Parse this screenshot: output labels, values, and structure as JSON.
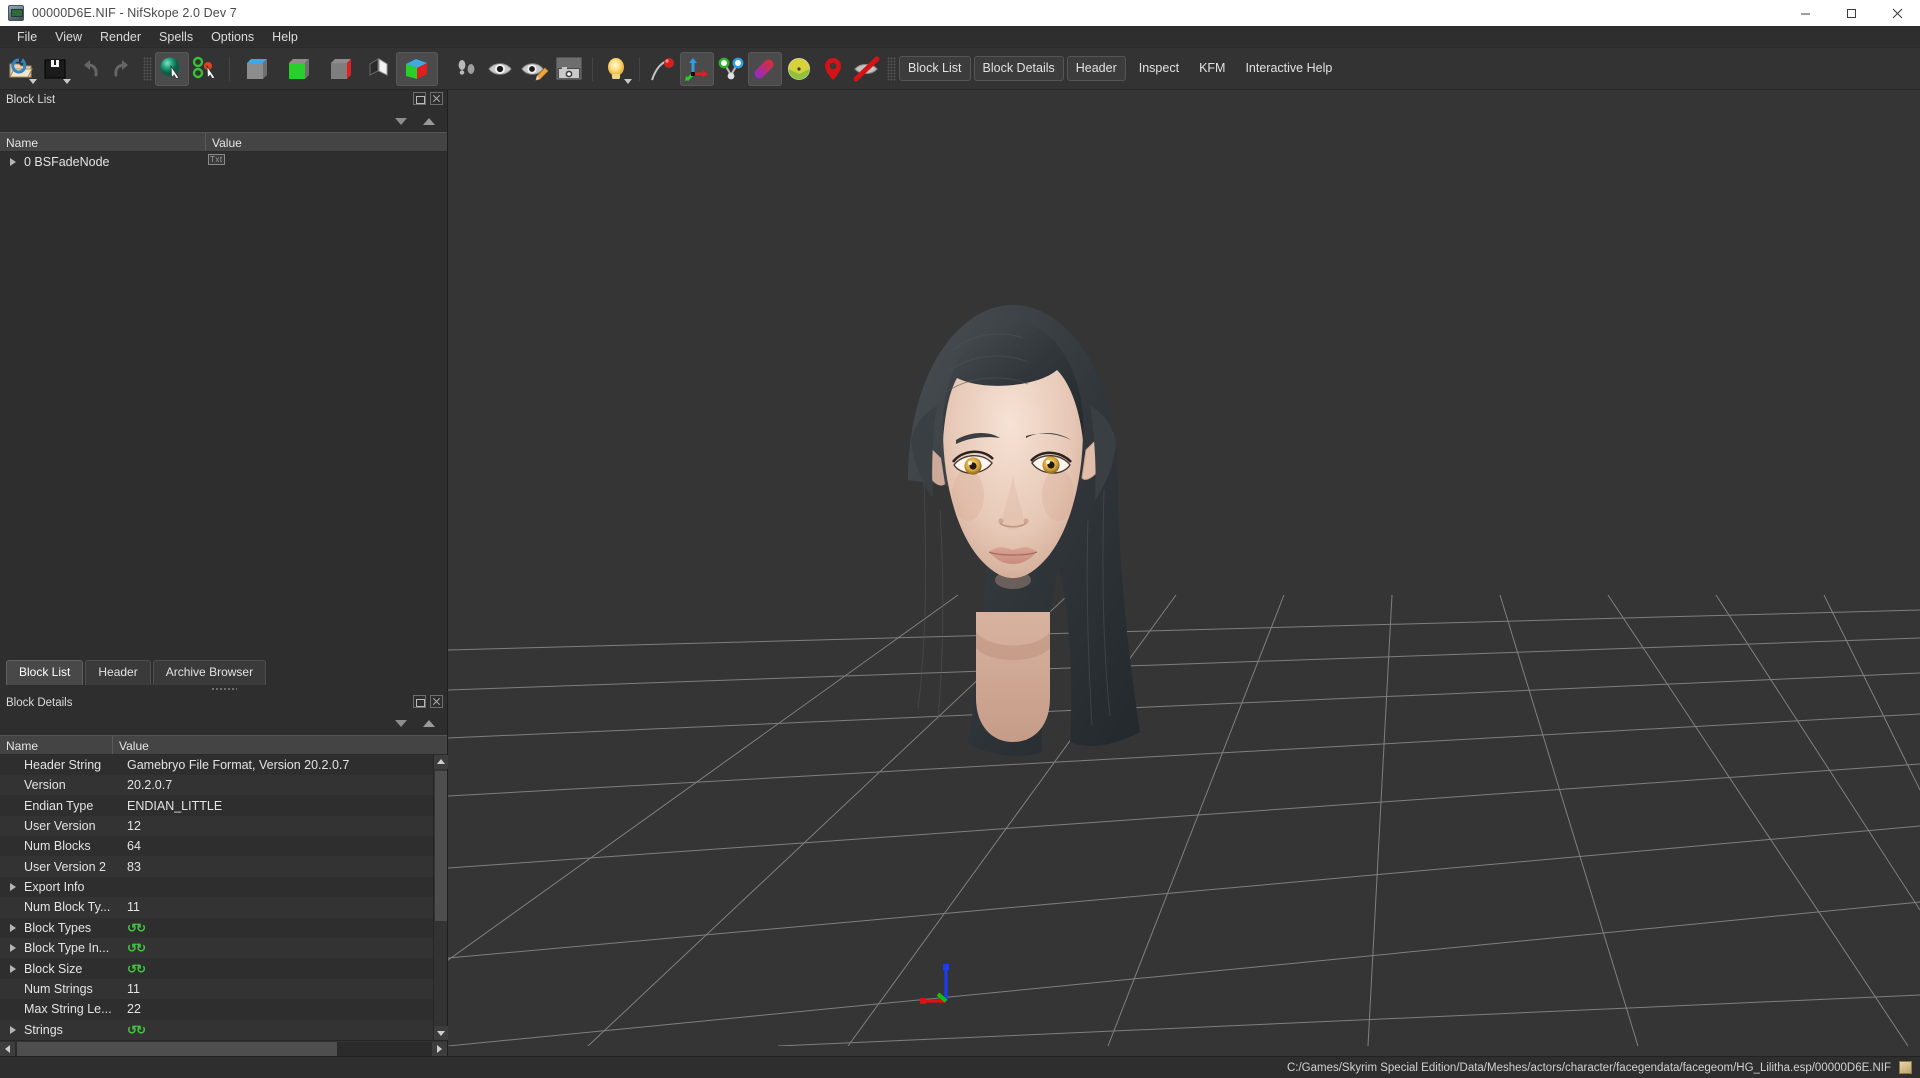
{
  "window": {
    "title": "00000D6E.NIF - NifSkope 2.0 Dev 7",
    "app_icon": "nifskope-app-icon",
    "buttons": {
      "minimize": "minimize-button",
      "maximize": "maximize-button",
      "close": "close-button"
    }
  },
  "menubar": {
    "items": [
      {
        "label": "File"
      },
      {
        "label": "View"
      },
      {
        "label": "Render"
      },
      {
        "label": "Spells"
      },
      {
        "label": "Options"
      },
      {
        "label": "Help"
      }
    ]
  },
  "toolbar": {
    "file_tools": [
      {
        "name": "open-file-button",
        "icon": "open-folder-icon",
        "has_dropdown": true
      },
      {
        "name": "save-file-button",
        "icon": "floppy-disk-icon",
        "has_dropdown": true
      },
      {
        "name": "undo-button",
        "icon": "undo-arrow-icon",
        "disabled": true
      },
      {
        "name": "redo-button",
        "icon": "redo-arrow-icon",
        "disabled": true
      }
    ],
    "view_tools": [
      {
        "name": "select-object-button",
        "icon": "green-sphere-cursor-icon",
        "active": true
      },
      {
        "name": "select-vertex-button",
        "icon": "nodes-cursor-icon",
        "active": false
      },
      {
        "name": "view-top-button",
        "icon": "top-view-cube-icon"
      },
      {
        "name": "view-front-button",
        "icon": "front-view-cube-icon"
      },
      {
        "name": "view-side-button",
        "icon": "side-view-cube-icon"
      },
      {
        "name": "view-flip-button",
        "icon": "flip-view-icon"
      },
      {
        "name": "view-perspective-button",
        "icon": "perspective-cube-icon",
        "active": true
      }
    ],
    "render_tools": [
      {
        "name": "walk-mode-button",
        "icon": "footprints-icon"
      },
      {
        "name": "show-hidden-button",
        "icon": "eye-icon"
      },
      {
        "name": "draw-nodes-button",
        "icon": "eye-pencil-icon"
      },
      {
        "name": "screenshot-button",
        "icon": "camera-icon"
      },
      {
        "name": "lighting-button",
        "icon": "light-bulb-icon",
        "has_dropdown": true
      },
      {
        "name": "draw-havok-button",
        "icon": "havok-curve-icon"
      },
      {
        "name": "draw-axes-button",
        "icon": "axes-arrows-icon",
        "active": true
      },
      {
        "name": "draw-nodes-links-button",
        "icon": "node-links-icon"
      },
      {
        "name": "draw-furniture-button",
        "icon": "furniture-marker-icon",
        "active": true
      },
      {
        "name": "draw-constraints-button",
        "icon": "constraint-dome-icon"
      },
      {
        "name": "draw-markers-button",
        "icon": "map-marker-icon"
      },
      {
        "name": "hide-marker-button",
        "icon": "crossed-marker-icon"
      }
    ],
    "panel_buttons": [
      {
        "label": "Block List",
        "boxed": true
      },
      {
        "label": "Block Details",
        "boxed": true
      },
      {
        "label": "Header",
        "boxed": true
      },
      {
        "label": "Inspect",
        "boxed": false
      },
      {
        "label": "KFM",
        "boxed": false
      },
      {
        "label": "Interactive Help",
        "boxed": false
      }
    ]
  },
  "block_list": {
    "dock_title": "Block List",
    "columns": [
      "Name",
      "Value"
    ],
    "rows": [
      {
        "name": "0 BSFadeNode",
        "value": "Txt",
        "expandable": true
      }
    ]
  },
  "tabs": [
    {
      "label": "Block List",
      "selected": true
    },
    {
      "label": "Header",
      "selected": false
    },
    {
      "label": "Archive Browser",
      "selected": false
    }
  ],
  "block_details": {
    "dock_title": "Block Details",
    "columns": [
      "Name",
      "Value"
    ],
    "rows": [
      {
        "name": "Header String",
        "value": "Gamebryo File Format, Version 20.2.0.7",
        "expandable": false
      },
      {
        "name": "Version",
        "value": "20.2.0.7",
        "expandable": false
      },
      {
        "name": "Endian Type",
        "value": "ENDIAN_LITTLE",
        "expandable": false
      },
      {
        "name": "User Version",
        "value": "12",
        "expandable": false
      },
      {
        "name": "Num Blocks",
        "value": "64",
        "expandable": false
      },
      {
        "name": "User Version 2",
        "value": "83",
        "expandable": false
      },
      {
        "name": "Export Info",
        "value": "",
        "expandable": true
      },
      {
        "name": "Num Block Ty...",
        "value": "11",
        "expandable": false
      },
      {
        "name": "Block Types",
        "value": "refresh",
        "expandable": true
      },
      {
        "name": "Block Type In...",
        "value": "refresh",
        "expandable": true
      },
      {
        "name": "Block Size",
        "value": "refresh",
        "expandable": true
      },
      {
        "name": "Num Strings",
        "value": "11",
        "expandable": false
      },
      {
        "name": "Max String Le...",
        "value": "22",
        "expandable": false
      },
      {
        "name": "Strings",
        "value": "refresh",
        "expandable": true
      }
    ]
  },
  "viewport": {
    "axis_labels": {
      "x": "x-axis-red",
      "y": "y-axis-green",
      "z": "z-axis-blue"
    },
    "background_color": "#353535",
    "grid_color": "#9a9a9a"
  },
  "statusbar": {
    "path": "C:/Games/Skyrim Special Edition/Data/Meshes/actors/character/facegendata/facegeom/HG_Lilitha.esp/00000D6E.NIF",
    "icon": "copy-path-icon"
  }
}
